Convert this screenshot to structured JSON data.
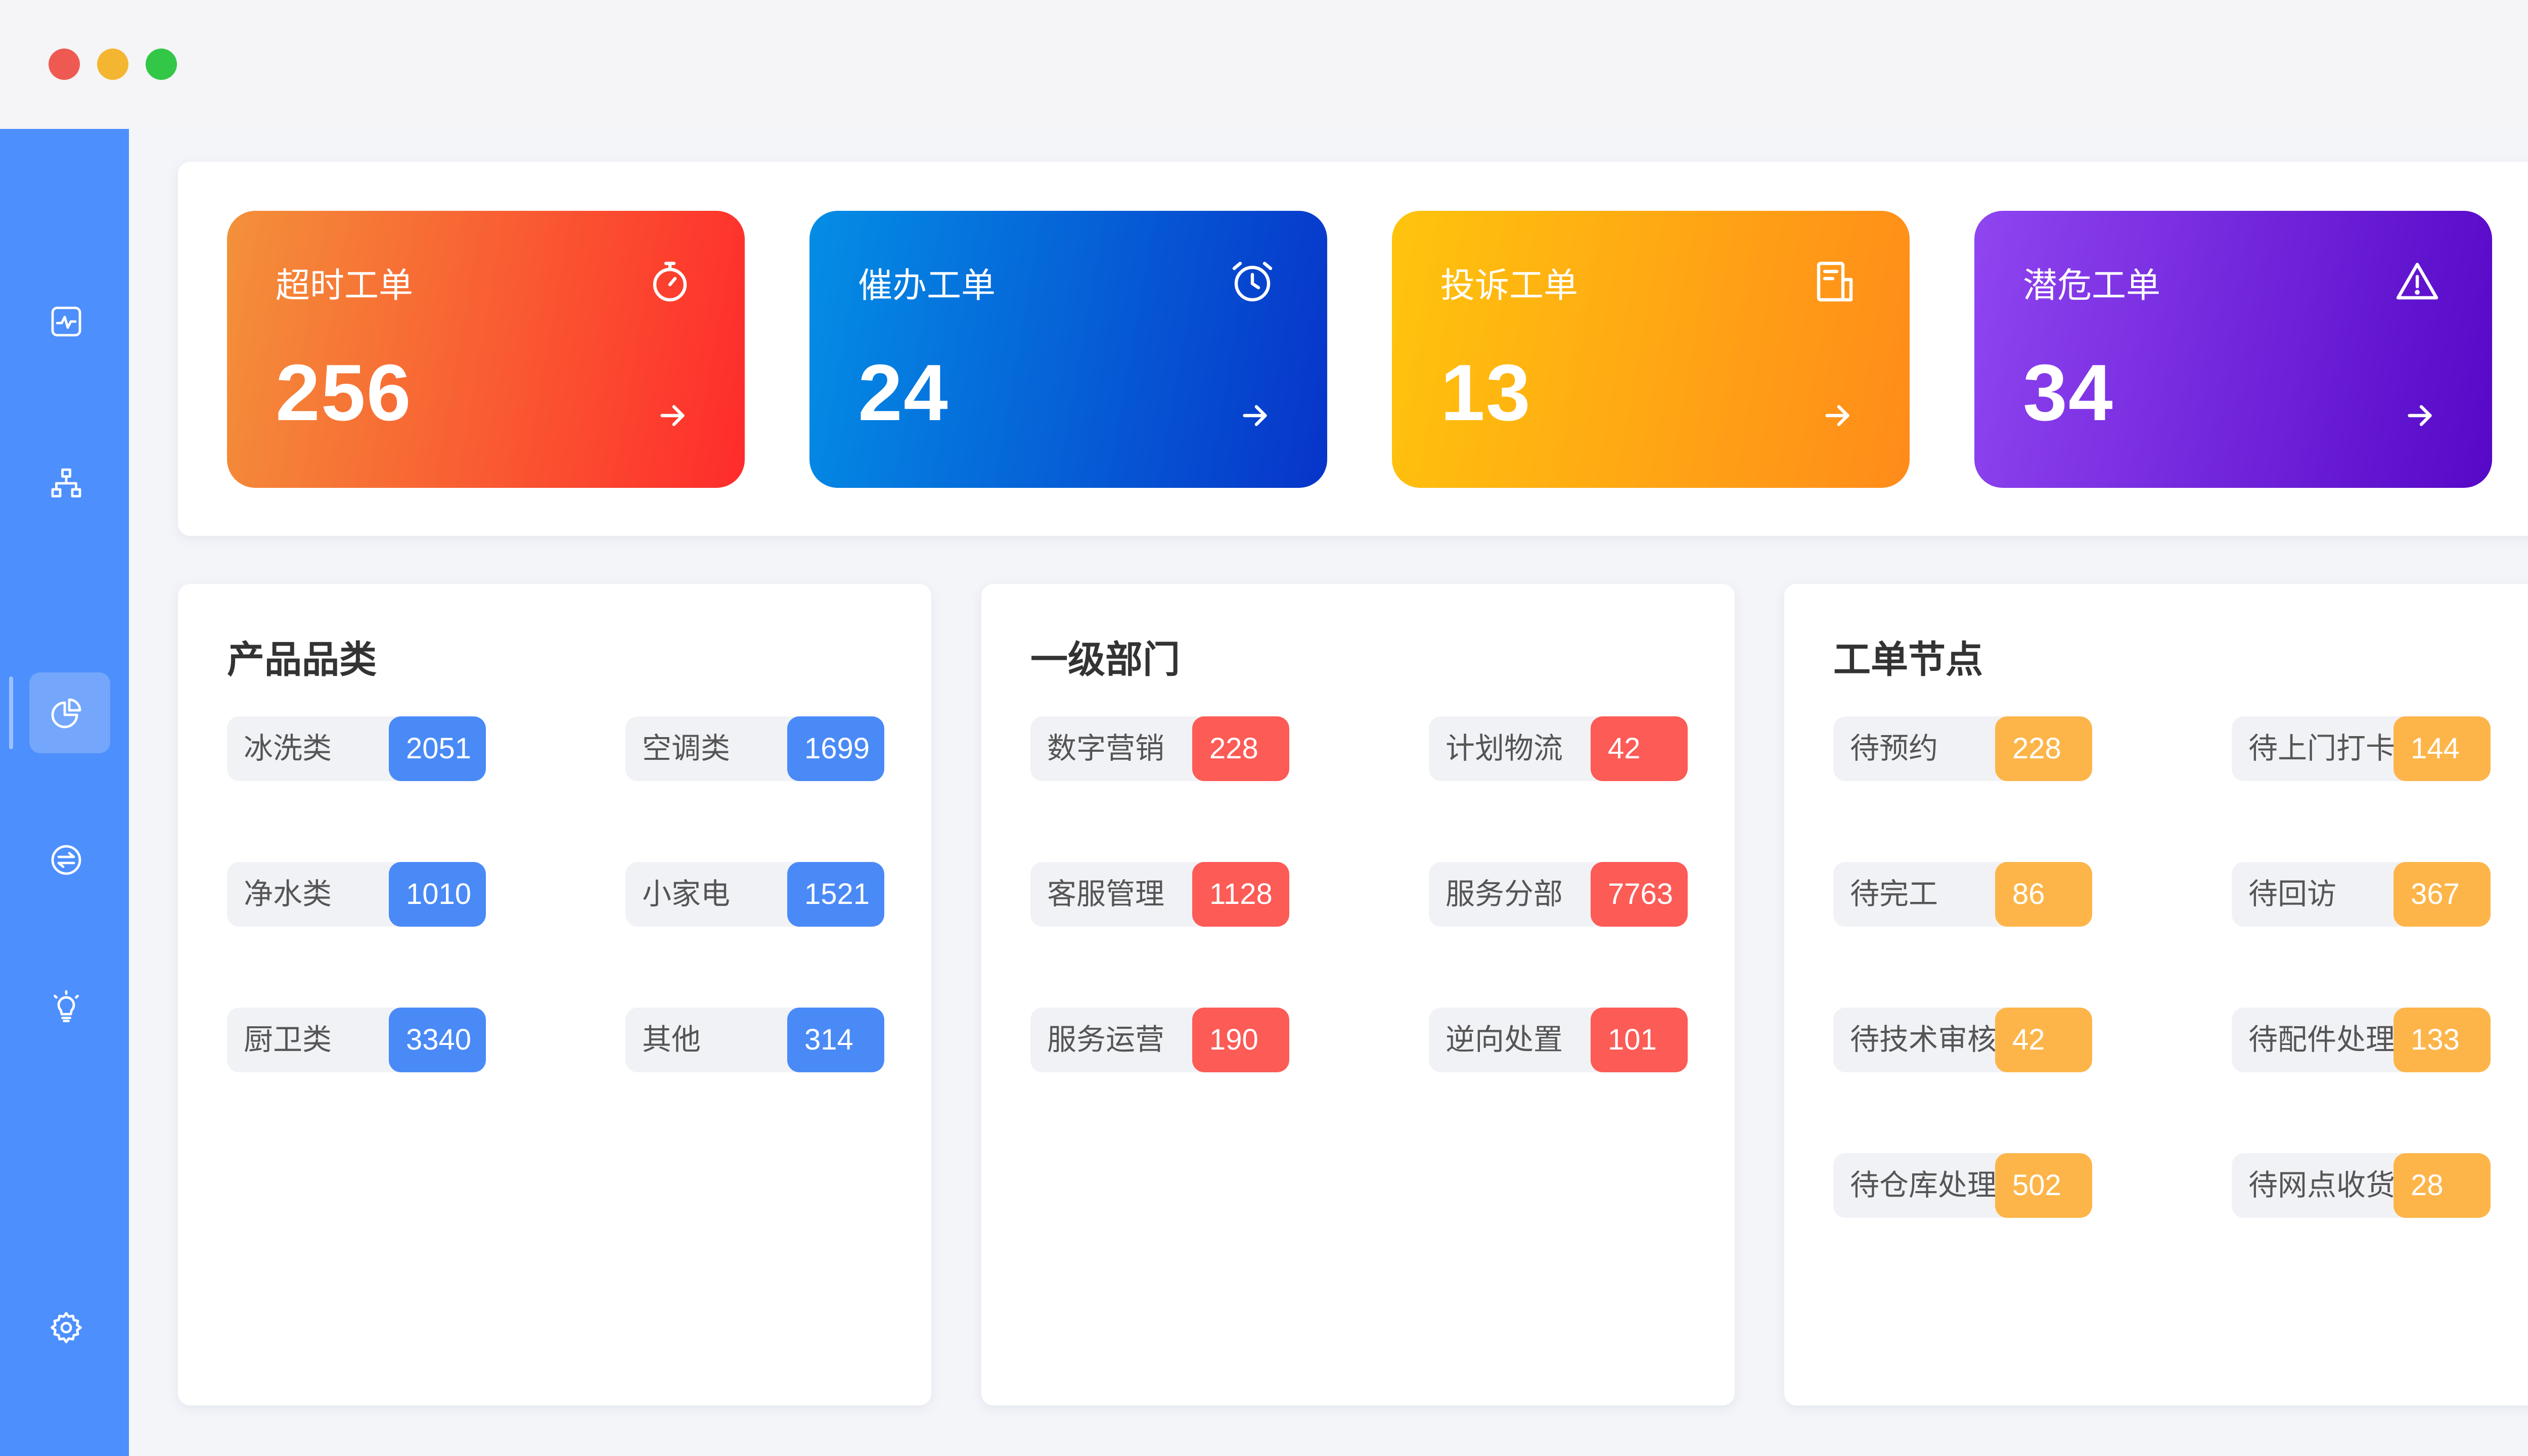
{
  "colors": {
    "sidebar": "#4d8ffc",
    "blue": "#4a8af7",
    "red": "#fc5b56",
    "amber": "#fdb54a"
  },
  "sidebar": {
    "items": [
      {
        "icon": "monitor-pulse-icon"
      },
      {
        "icon": "org-chart-icon"
      },
      {
        "icon": "pie-chart-icon",
        "active": true
      },
      {
        "icon": "transfer-icon"
      },
      {
        "icon": "lightbulb-icon"
      },
      {
        "icon": "gear-icon"
      }
    ]
  },
  "stats": [
    {
      "title": "超时工单",
      "value": "256",
      "icon": "stopwatch-icon"
    },
    {
      "title": "催办工单",
      "value": "24",
      "icon": "alarm-clock-icon"
    },
    {
      "title": "投诉工单",
      "value": "13",
      "icon": "document-icon"
    },
    {
      "title": "潜危工单",
      "value": "34",
      "icon": "warning-icon"
    }
  ],
  "panels": {
    "product": {
      "title": "产品品类",
      "items": [
        {
          "label": "冰洗类",
          "value": "2051"
        },
        {
          "label": "空调类",
          "value": "1699"
        },
        {
          "label": "净水类",
          "value": "1010"
        },
        {
          "label": "小家电",
          "value": "1521"
        },
        {
          "label": "厨卫类",
          "value": "3340"
        },
        {
          "label": "其他",
          "value": "314"
        }
      ]
    },
    "dept": {
      "title": "一级部门",
      "items": [
        {
          "label": "数字营销",
          "value": "228"
        },
        {
          "label": "计划物流",
          "value": "42"
        },
        {
          "label": "客服管理",
          "value": "1128"
        },
        {
          "label": "服务分部",
          "value": "7763"
        },
        {
          "label": "服务运营",
          "value": "190"
        },
        {
          "label": "逆向处置",
          "value": "101"
        }
      ]
    },
    "node": {
      "title": "工单节点",
      "items": [
        {
          "label": "待预约",
          "value": "228"
        },
        {
          "label": "待上门打卡",
          "value": "144"
        },
        {
          "label": "待完工",
          "value": "86"
        },
        {
          "label": "待回访",
          "value": "367"
        },
        {
          "label": "待技术审核",
          "value": "42"
        },
        {
          "label": "待配件处理",
          "value": "133"
        },
        {
          "label": "待仓库处理",
          "value": "502"
        },
        {
          "label": "待网点收货",
          "value": "28"
        }
      ]
    }
  }
}
